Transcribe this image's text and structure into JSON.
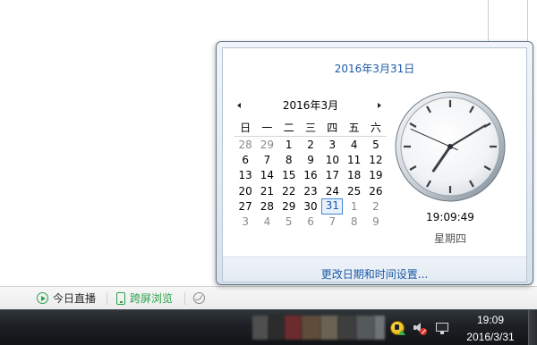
{
  "colors": {
    "link_blue": "#1c5aa8",
    "muted_day": "#8a8a8a",
    "selected_border": "#3e86d6",
    "selected_fill": "#e8f1fb",
    "status_green": "#2aa24a"
  },
  "browser_status": {
    "items": [
      {
        "label": "今日直播",
        "icon": "play-circle-icon"
      },
      {
        "label": "跨屏浏览",
        "icon": "mobile-phone-icon"
      },
      {
        "icon": "leaf-circle-icon"
      }
    ]
  },
  "flyout": {
    "full_date": "2016年3月31日",
    "calendar": {
      "prev_icon": "prev-month-icon",
      "next_icon": "next-month-icon",
      "month_title": "2016年3月",
      "weekdays": [
        "日",
        "一",
        "二",
        "三",
        "四",
        "五",
        "六"
      ],
      "weeks": [
        [
          {
            "d": "28",
            "other": true
          },
          {
            "d": "29",
            "other": true
          },
          {
            "d": "1"
          },
          {
            "d": "2"
          },
          {
            "d": "3"
          },
          {
            "d": "4"
          },
          {
            "d": "5"
          }
        ],
        [
          {
            "d": "6"
          },
          {
            "d": "7"
          },
          {
            "d": "8"
          },
          {
            "d": "9"
          },
          {
            "d": "10"
          },
          {
            "d": "11"
          },
          {
            "d": "12"
          }
        ],
        [
          {
            "d": "13"
          },
          {
            "d": "14"
          },
          {
            "d": "15"
          },
          {
            "d": "16"
          },
          {
            "d": "17"
          },
          {
            "d": "18"
          },
          {
            "d": "19"
          }
        ],
        [
          {
            "d": "20"
          },
          {
            "d": "21"
          },
          {
            "d": "22"
          },
          {
            "d": "23"
          },
          {
            "d": "24"
          },
          {
            "d": "25"
          },
          {
            "d": "26"
          }
        ],
        [
          {
            "d": "27"
          },
          {
            "d": "28"
          },
          {
            "d": "29"
          },
          {
            "d": "30"
          },
          {
            "d": "31",
            "selected": true
          },
          {
            "d": "1",
            "other": true
          },
          {
            "d": "2",
            "other": true
          }
        ],
        [
          {
            "d": "3",
            "other": true
          },
          {
            "d": "4",
            "other": true
          },
          {
            "d": "5",
            "other": true
          },
          {
            "d": "6",
            "other": true
          },
          {
            "d": "7",
            "other": true
          },
          {
            "d": "8",
            "other": true
          },
          {
            "d": "9",
            "other": true
          }
        ]
      ]
    },
    "clock": {
      "hour": 19,
      "minute": 9,
      "second": 49,
      "digital": "19:09:49",
      "weekday": "星期四"
    },
    "settings_link": "更改日期和时间设置..."
  },
  "taskbar": {
    "tray_icons": [
      "security-shield-icon",
      "volume-muted-icon",
      "network-icon"
    ],
    "time": "19:09",
    "date": "2016/3/31"
  }
}
